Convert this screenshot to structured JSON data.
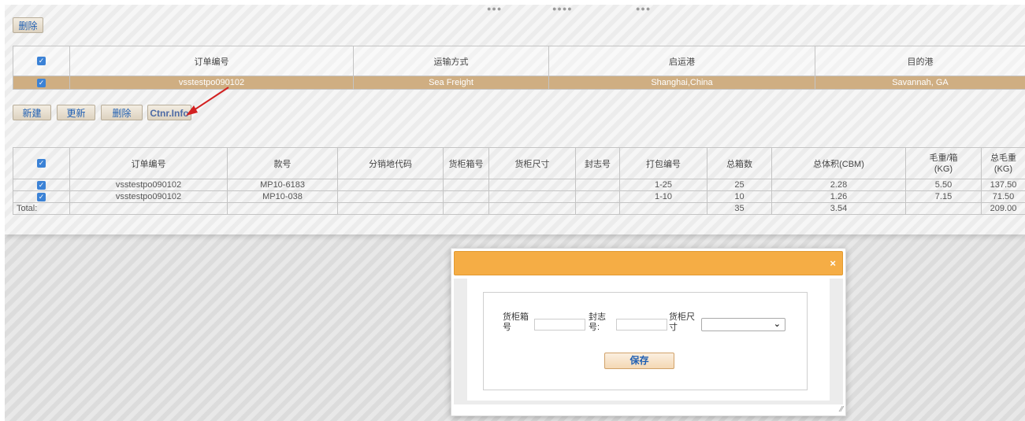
{
  "toolbar_top": {
    "delete_label": "删除"
  },
  "order_table": {
    "headers": [
      "订单编号",
      "运输方式",
      "启运港",
      "目的港"
    ],
    "rows": [
      {
        "order_no": "vsstestpo090102",
        "shipping": "Sea Freight",
        "origin": "Shanghai,China",
        "dest": "Savannah, GA"
      }
    ]
  },
  "toolbar_mid": {
    "new_label": "新建",
    "update_label": "更新",
    "delete_label": "删除",
    "ctnr_label": "Ctnr.Info"
  },
  "detail_table": {
    "headers": [
      "订单编号",
      "款号",
      "分销地代码",
      "货柜箱号",
      "货柜尺寸",
      "封志号",
      "打包编号",
      "总箱数",
      "总体积(CBM)",
      "毛重/箱\n(KG)",
      "总毛重\n(KG)"
    ],
    "header_wt_line1": "毛重/箱",
    "header_wt_line2": "(KG)",
    "header_twt_line1": "总毛重",
    "header_twt_line2": "(KG)",
    "rows": [
      {
        "order_no": "vsstestpo090102",
        "style": "MP10-6183",
        "dist": "",
        "ctnr_no": "",
        "ctnr_size": "",
        "seal": "",
        "pack": "1-25",
        "cartons": "25",
        "cbm": "2.28",
        "wt_per": "5.50",
        "total_wt": "137.50"
      },
      {
        "order_no": "vsstestpo090102",
        "style": "MP10-038",
        "dist": "",
        "ctnr_no": "",
        "ctnr_size": "",
        "seal": "",
        "pack": "1-10",
        "cartons": "10",
        "cbm": "1.26",
        "wt_per": "7.15",
        "total_wt": "71.50"
      }
    ],
    "total": {
      "label": "Total:",
      "cartons": "35",
      "cbm": "3.54",
      "total_wt": "209.00"
    }
  },
  "modal": {
    "close_glyph": "×",
    "ctnr_no_label": "货柜箱号",
    "seal_label": "封志号:",
    "size_label": "货柜尺寸",
    "ctnr_no_value": "",
    "seal_value": "",
    "size_value": "",
    "save_label": "保存"
  },
  "icons": {
    "arrow_color": "#d22020",
    "checkbox_color": "#3b82d6",
    "modal_header_color": "#f5ad45"
  }
}
